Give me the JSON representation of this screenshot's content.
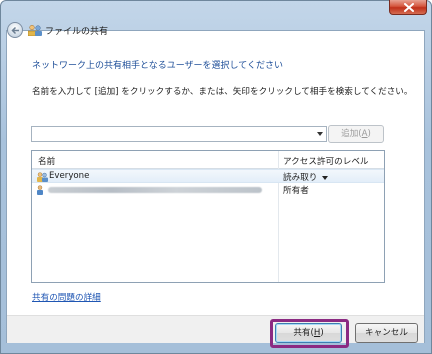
{
  "window": {
    "title": "ファイルの共有",
    "close_icon": "close-icon",
    "back_icon": "back-arrow-icon"
  },
  "dialog": {
    "heading": "ネットワーク上の共有相手となるユーザーを選択してください",
    "instruction": "名前を入力して [追加] をクリックするか、または、矢印をクリックして相手を検索してください。",
    "combo": {
      "value": ""
    },
    "add_button": {
      "label": "追加(",
      "accel": "A",
      "suffix": ")"
    },
    "list": {
      "columns": [
        "名前",
        "アクセス許可のレベル"
      ],
      "rows": [
        {
          "name": "Everyone",
          "permission": "読み取り",
          "has_dropdown": true,
          "selected": true,
          "icon": "group-users-icon"
        },
        {
          "name": "",
          "permission": "所有者",
          "has_dropdown": false,
          "selected": false,
          "icon": "user-icon",
          "name_obscured": true
        }
      ]
    },
    "help_link": "共有の問題の詳細"
  },
  "footer": {
    "share_button": {
      "label": "共有(",
      "accel": "H",
      "suffix": ")"
    },
    "cancel_button": {
      "label": "キャンセル"
    }
  },
  "colors": {
    "heading": "#1f4f99",
    "link": "#1f56b3",
    "highlight": "#8b2a82",
    "close": "#c0301a"
  }
}
